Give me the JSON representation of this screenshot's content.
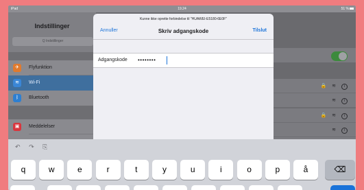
{
  "status_bar": {
    "device": "iPad",
    "time": "19.24",
    "battery": "51 %"
  },
  "sidebar": {
    "title": "Indstillinger",
    "search_placeholder": "Q Indstillinger",
    "items": [
      {
        "label": "Flyfunktion",
        "icon": "airplane-icon",
        "color": "#e07a2e",
        "glyph": "✈"
      },
      {
        "label": "Wi-Fi",
        "icon": "wifi-icon",
        "color": "#2e7fd1",
        "glyph": "≋",
        "active": true
      },
      {
        "label": "Bluetooth",
        "icon": "bluetooth-icon",
        "color": "#2e7fd1",
        "glyph": "ᛒ"
      },
      {
        "label": "Meddelelser",
        "icon": "notifications-icon",
        "color": "#d9363e",
        "glyph": "▣"
      }
    ]
  },
  "modal": {
    "prompt": "Kunne ikke oprette forbindelse til \"HUAWEI-E5180-6E0F\"",
    "cancel_label": "Annuller",
    "title": "Skriv adgangskode",
    "join_label": "Tilslut",
    "field_label": "Adgangskode",
    "field_value": "••••••••"
  },
  "network_icons": "🔒 ≋",
  "keyboard": {
    "tools": [
      "undo-icon",
      "redo-icon",
      "paste-icon"
    ],
    "row1": [
      "q",
      "w",
      "e",
      "r",
      "t",
      "y",
      "u",
      "i",
      "o",
      "p",
      "å"
    ],
    "delete_label": "⌫",
    "accent_color": "#1a73d9"
  }
}
